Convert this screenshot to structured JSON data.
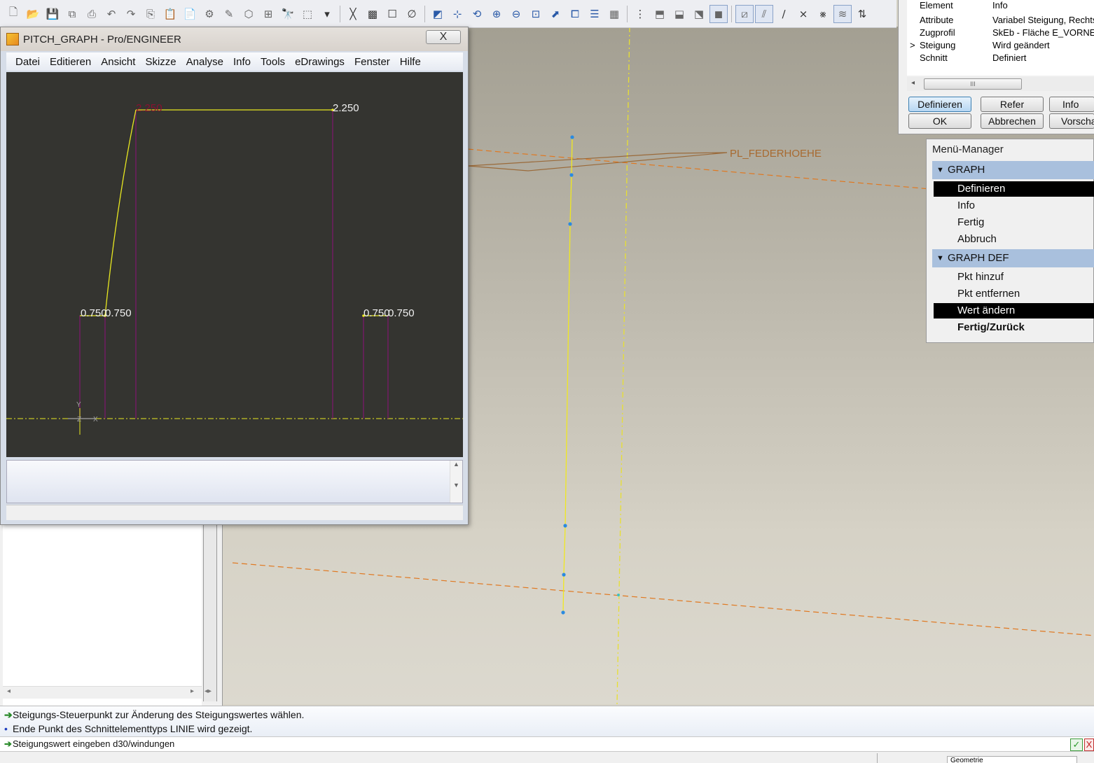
{
  "pitch_window": {
    "title": "PITCH_GRAPH - Pro/ENGINEER",
    "close_label": "X",
    "menu": [
      "Datei",
      "Editieren",
      "Ansicht",
      "Skizze",
      "Analyse",
      "Info",
      "Tools",
      "eDrawings",
      "Fenster",
      "Hilfe"
    ],
    "graph_labels": {
      "top_left": "2.250",
      "top_right": "2.250",
      "left_a": "0.750",
      "left_b": "0.750",
      "right_a": "0.750",
      "right_b": "0.750",
      "axis_y": "Y",
      "axis_x": "X",
      "axis_z": "Z"
    }
  },
  "feature_dialog": {
    "header_col1": "Element",
    "header_col2": "Info",
    "rows": [
      {
        "mark": "",
        "name": "Attribute",
        "info": "Variabel Steigung, Rechts"
      },
      {
        "mark": "",
        "name": "Zugprofil",
        "info": "SkEb - Fläche E_VORNE"
      },
      {
        "mark": ">",
        "name": "Steigung",
        "info": "Wird geändert"
      },
      {
        "mark": "",
        "name": "Schnitt",
        "info": "Definiert"
      }
    ],
    "scroll_thumb": "III",
    "buttons": {
      "define": "Definieren",
      "refer": "Refer",
      "info": "Info",
      "ok": "OK",
      "cancel": "Abbrechen",
      "preview": "Vorschau"
    }
  },
  "menu_manager": {
    "title": "Menü-Manager",
    "sections": [
      {
        "label": "GRAPH",
        "items": [
          "Definieren",
          "Info",
          "Fertig",
          "Abbruch"
        ]
      },
      {
        "label": "GRAPH DEF",
        "items": [
          "Pkt hinzuf",
          "Pkt entfernen",
          "Wert ändern",
          "Fertig/Zurück"
        ]
      }
    ]
  },
  "viewport": {
    "datum_label": "PL_FEDERHOEHE"
  },
  "messages": {
    "line1": "Steigungs-Steuerpunkt zur Änderung des Steigungswertes wählen.",
    "line2": "Ende Punkt des Schnittelementtyps LINIE wird gezeigt.",
    "prompt": "Steigungswert eingeben d30/windungen",
    "ok_symbol": "✓",
    "cancel_symbol": "X",
    "status_select": "Geometrie"
  },
  "colors": {
    "graph_bg": "#343430",
    "graph_curve": "#e8e820",
    "graph_dim": "#7a1a6a",
    "datum_orange": "#e08020",
    "menu_header": "#a9c0dd"
  }
}
